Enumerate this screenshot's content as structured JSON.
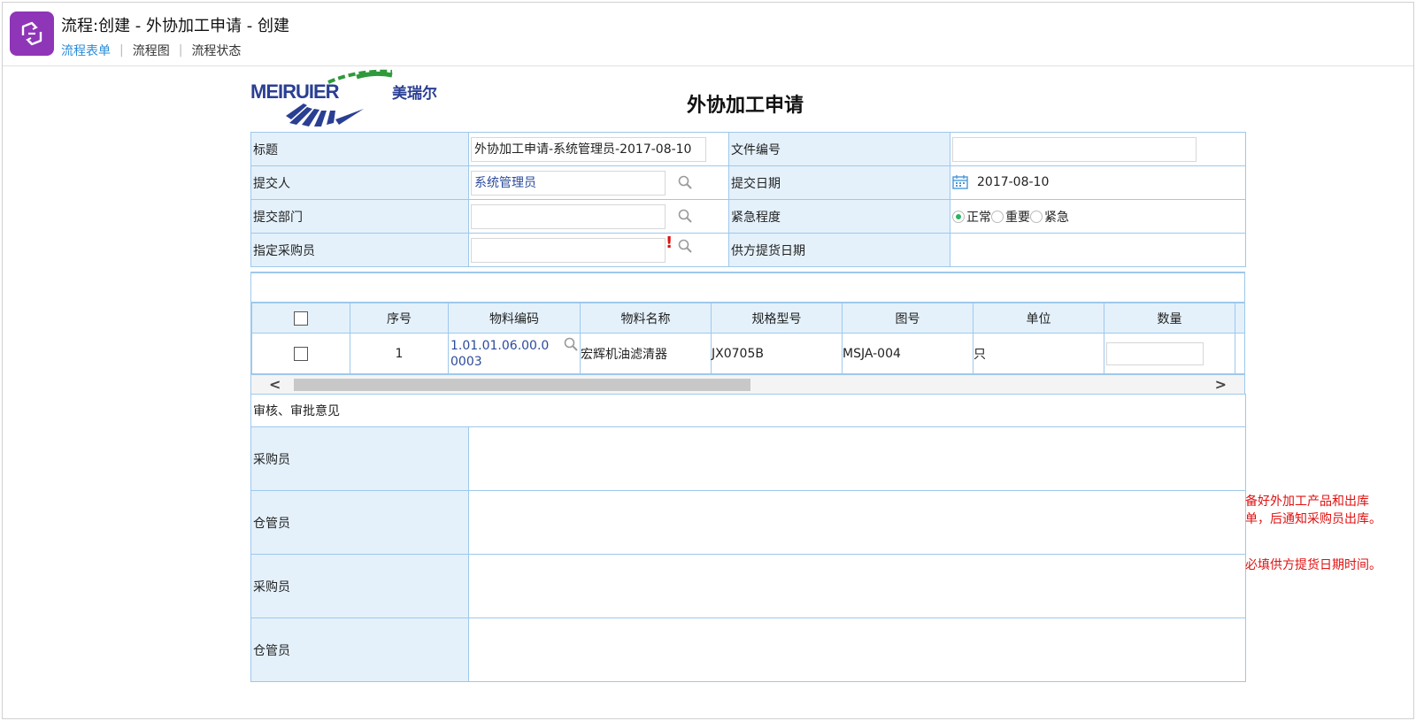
{
  "header": {
    "title": "流程:创建 - 外协加工申请 - 创建",
    "tabs": [
      {
        "label": "流程表单",
        "active": true
      },
      {
        "label": "流程图",
        "active": false
      },
      {
        "label": "流程状态",
        "active": false
      }
    ]
  },
  "logo": {
    "text_en": "MEIRUIER",
    "text_cn": "美瑞尔"
  },
  "form": {
    "title": "外协加工申请",
    "rows": [
      {
        "label": "标题",
        "value": "外协加工申请-系统管理员-2017-08-10",
        "label2": "文件编号",
        "value2": ""
      },
      {
        "label": "提交人",
        "value": "系统管理员",
        "label2": "提交日期",
        "value2": "2017-08-10"
      },
      {
        "label": "提交部门",
        "value": "",
        "label2": "紧急程度",
        "value2": ""
      },
      {
        "label": "指定采购员",
        "value": "",
        "label2": "供方提货日期",
        "value2": ""
      }
    ],
    "urgency_options": [
      {
        "label": "正常",
        "checked": true
      },
      {
        "label": "重要",
        "checked": false
      },
      {
        "label": "紧急",
        "checked": false
      }
    ],
    "required_mark": "!"
  },
  "detail": {
    "columns": [
      "",
      "序号",
      "物料编码",
      "物料名称",
      "规格型号",
      "图号",
      "单位",
      "数量"
    ],
    "rows": [
      {
        "seq": "1",
        "code": "1.01.01.06.00.00003",
        "name": "宏辉机油滤清器",
        "spec": "JX0705B",
        "drawing": "MSJA-004",
        "unit": "只",
        "qty": ""
      }
    ],
    "scroll_left": "<",
    "scroll_right": ">"
  },
  "approval": {
    "section_label": "审核、审批意见",
    "rows": [
      {
        "label": "采购员"
      },
      {
        "label": "仓管员"
      },
      {
        "label": "采购员"
      },
      {
        "label": "仓管员"
      }
    ]
  },
  "notes": {
    "note1": "备好外加工产品和出库单，后通知采购员出库。",
    "note2": "必填供方提货日期时间。"
  },
  "colors": {
    "accent": "#2a8bd6",
    "app_icon": "#8e35b8",
    "label_bg": "#e4f1fb",
    "border": "#9ec8ec",
    "note": "#e01010"
  }
}
